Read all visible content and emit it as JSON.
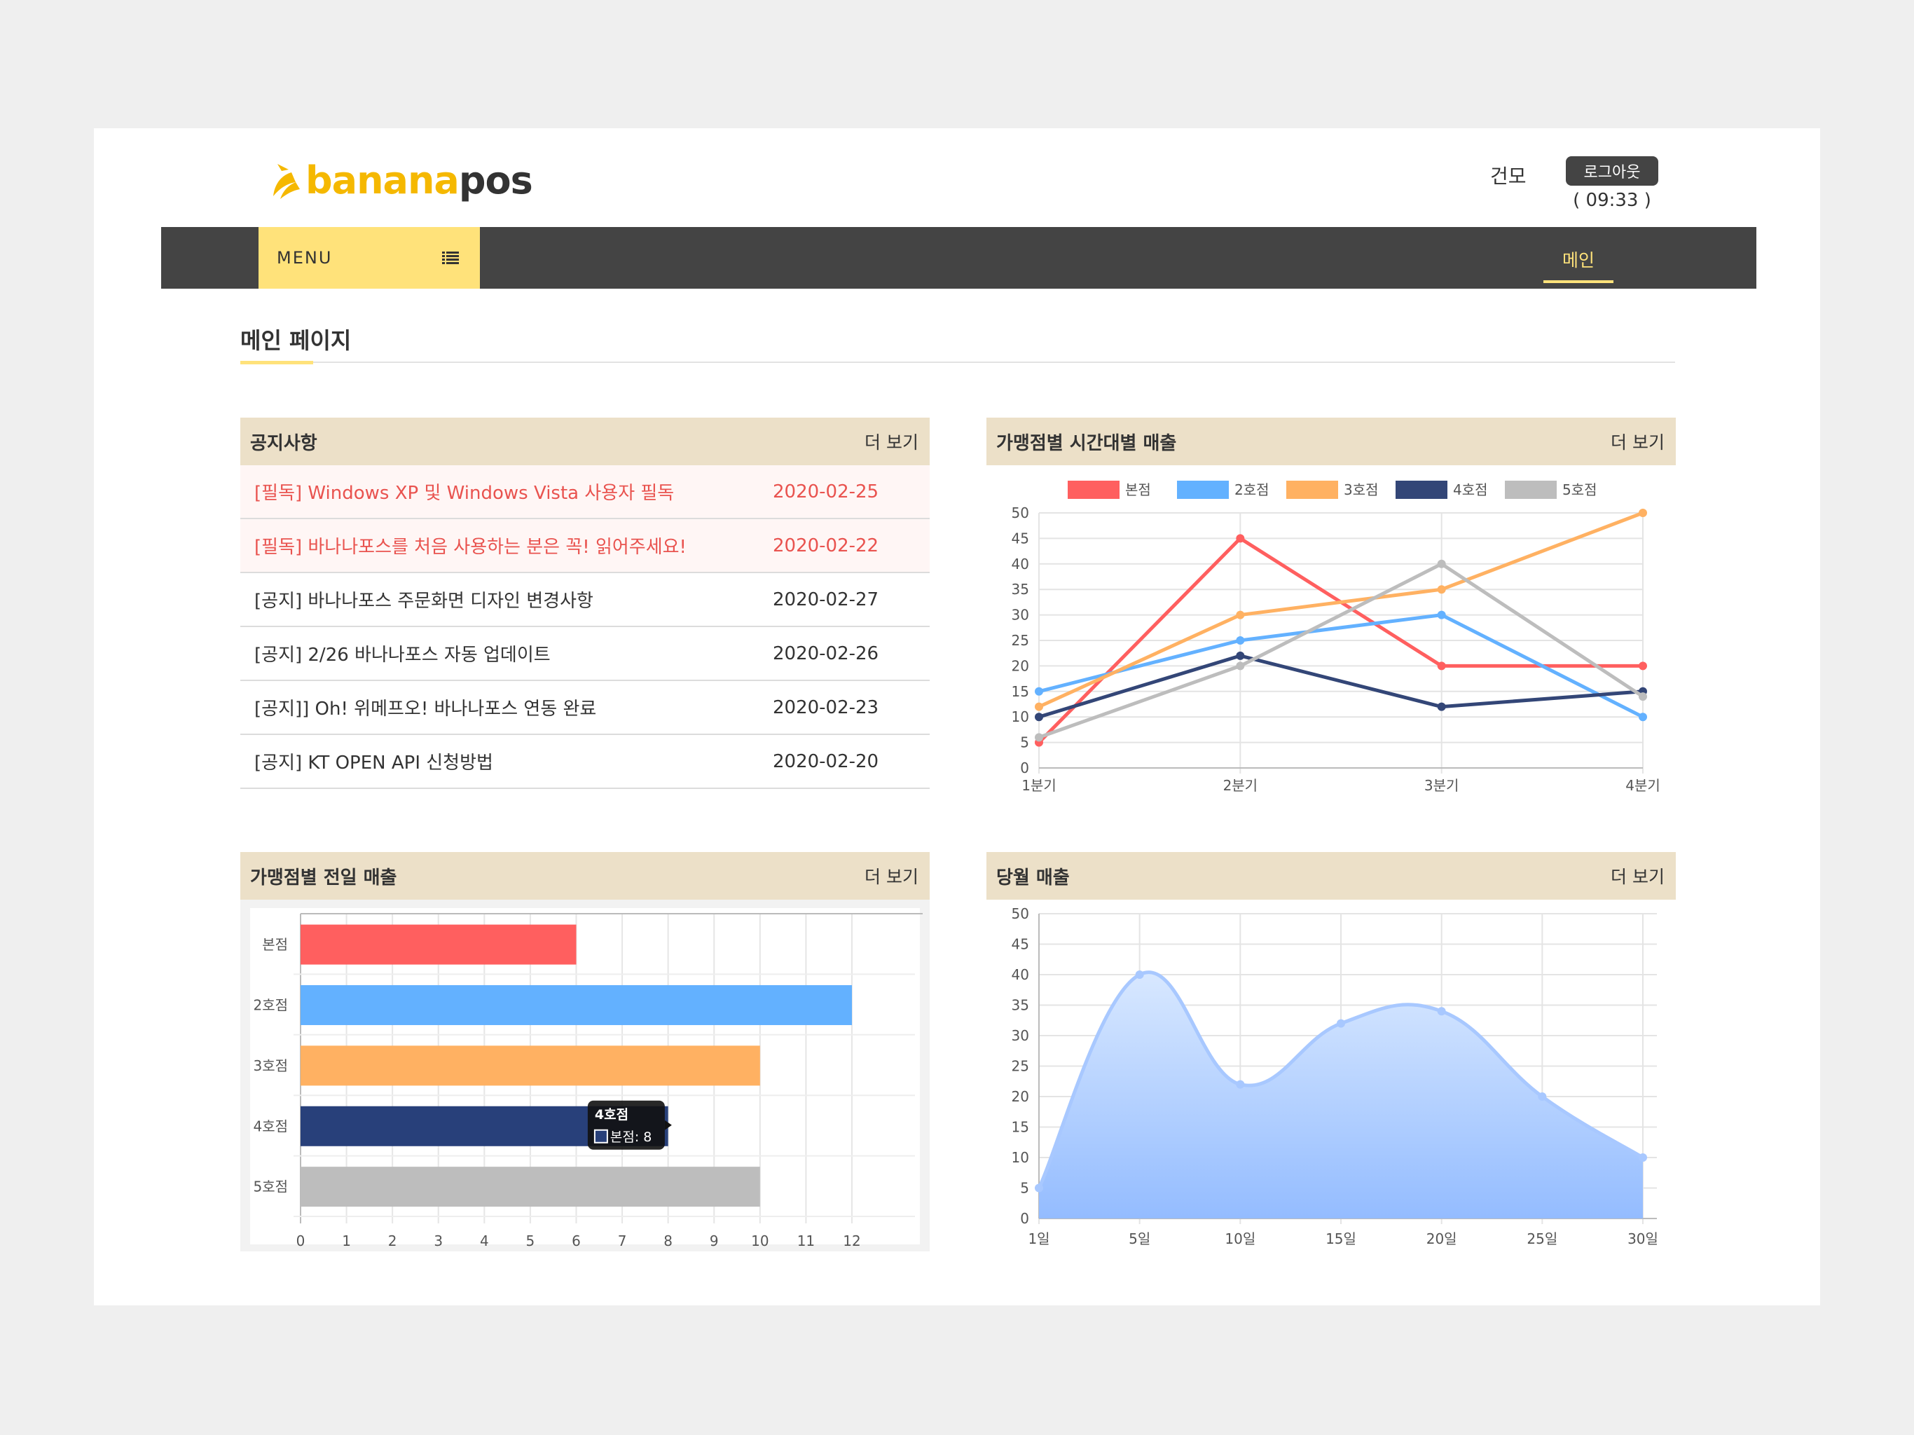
{
  "header": {
    "logo_part1": "banana",
    "logo_part2": "pos",
    "user_name": "건모",
    "logout_label": "로그아웃",
    "session_time": "( 09:33 )"
  },
  "nav": {
    "menu_label": "MENU",
    "main_label": "메인"
  },
  "page_title": "메인 페이지",
  "notice": {
    "title": "공지사항",
    "more_label": "더 보기",
    "items": [
      {
        "title": "[필독] Windows XP 및 Windows Vista 사용자 필독",
        "date": "2020-02-25",
        "pinned": true
      },
      {
        "title": "[필독] 바나나포스를 처음 사용하는 분은 꼭! 읽어주세요!",
        "date": "2020-02-22",
        "pinned": true
      },
      {
        "title": "[공지] 바나나포스 주문화면 디자인 변경사항",
        "date": "2020-02-27",
        "pinned": false
      },
      {
        "title": "[공지] 2/26 바나나포스 자동 업데이트",
        "date": "2020-02-26",
        "pinned": false
      },
      {
        "title": "[공지]] Oh! 위메프오! 바나나포스 연동 완료",
        "date": "2020-02-23",
        "pinned": false
      },
      {
        "title": "[공지] KT OPEN API 신청방법",
        "date": "2020-02-20",
        "pinned": false
      }
    ]
  },
  "colors": {
    "accent": "#ffe27a",
    "nav_bg": "#444444",
    "panel_head": "#ece0c8",
    "pinned_text": "#e9534f"
  },
  "chart_data": [
    {
      "type": "line",
      "title": "가맹점별 시간대별 매출",
      "more_label": "더 보기",
      "categories": [
        "1분기",
        "2분기",
        "3분기",
        "4분기"
      ],
      "ylim": [
        0,
        50
      ],
      "yticks": [
        0,
        5,
        10,
        15,
        20,
        25,
        30,
        35,
        40,
        45,
        50
      ],
      "grid": true,
      "legend": "top",
      "series": [
        {
          "name": "본점",
          "color": "#ff5f5f",
          "values": [
            5,
            45,
            20,
            20
          ]
        },
        {
          "name": "2호점",
          "color": "#63b1ff",
          "values": [
            15,
            25,
            30,
            10
          ]
        },
        {
          "name": "3호점",
          "color": "#ffb162",
          "values": [
            12,
            30,
            35,
            50
          ]
        },
        {
          "name": "4호점",
          "color": "#334677",
          "values": [
            10,
            22,
            12,
            15
          ]
        },
        {
          "name": "5호점",
          "color": "#bdbdbd",
          "values": [
            6,
            20,
            40,
            14
          ]
        }
      ]
    },
    {
      "type": "bar",
      "orientation": "horizontal",
      "title": "가맹점별 전일 매출",
      "more_label": "더 보기",
      "categories": [
        "본점",
        "2호점",
        "3호점",
        "4호점",
        "5호점"
      ],
      "values": [
        6,
        12,
        10,
        8,
        10
      ],
      "colors": [
        "#ff5f5f",
        "#63b1ff",
        "#ffb162",
        "#28407a",
        "#bdbdbd"
      ],
      "xlim": [
        0,
        12
      ],
      "xticks": [
        0,
        1,
        2,
        3,
        4,
        5,
        6,
        7,
        8,
        9,
        10,
        11,
        12
      ],
      "grid": true,
      "tooltip": {
        "title": "4호점",
        "label": "본점: 8"
      }
    },
    {
      "type": "area",
      "title": "당월 매출",
      "more_label": "더 보기",
      "categories": [
        "1일",
        "5일",
        "10일",
        "15일",
        "20일",
        "25일",
        "30일"
      ],
      "values": [
        5,
        40,
        22,
        32,
        34,
        20,
        10
      ],
      "ylim": [
        0,
        50
      ],
      "yticks": [
        0,
        5,
        10,
        15,
        20,
        25,
        30,
        35,
        40,
        45,
        50
      ],
      "color": "#a8c8ff",
      "grid": true
    }
  ]
}
